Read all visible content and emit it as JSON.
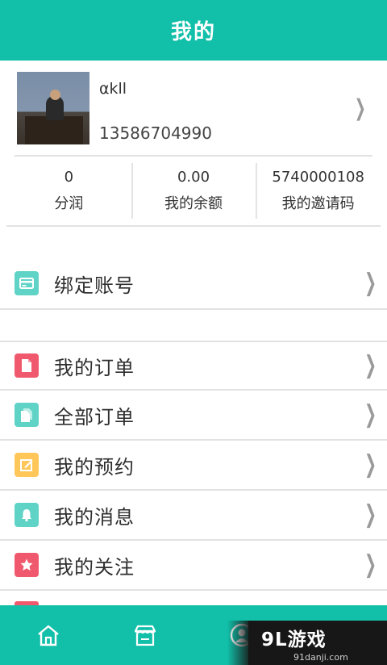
{
  "header": {
    "title": "我的"
  },
  "profile": {
    "name": "αkll",
    "phone": "13586704990"
  },
  "stats": [
    {
      "value": "0",
      "label": "分润"
    },
    {
      "value": "0.00",
      "label": "我的余额"
    },
    {
      "value": "5740000108",
      "label": "我的邀请码"
    }
  ],
  "menu_group_1": [
    {
      "label": "绑定账号",
      "icon": "card-icon",
      "color": "#5fd3c6"
    }
  ],
  "menu_group_2": [
    {
      "label": "我的订单",
      "icon": "document-icon",
      "color": "#f0596d"
    },
    {
      "label": "全部订单",
      "icon": "documents-icon",
      "color": "#5fd3c6"
    },
    {
      "label": "我的预约",
      "icon": "edit-icon",
      "color": "#ffc75a"
    },
    {
      "label": "我的消息",
      "icon": "bell-icon",
      "color": "#5fd3c6"
    },
    {
      "label": "我的关注",
      "icon": "star-icon",
      "color": "#f0596d"
    }
  ],
  "tabbar": {
    "tabs": [
      "home-icon",
      "store-icon",
      "profile-icon"
    ],
    "active": "profile-icon"
  },
  "watermark": {
    "main": "9L游戏",
    "sub": "91danji.com"
  },
  "colors": {
    "accent": "#12bfa9",
    "divider": "#e2e2e2"
  }
}
